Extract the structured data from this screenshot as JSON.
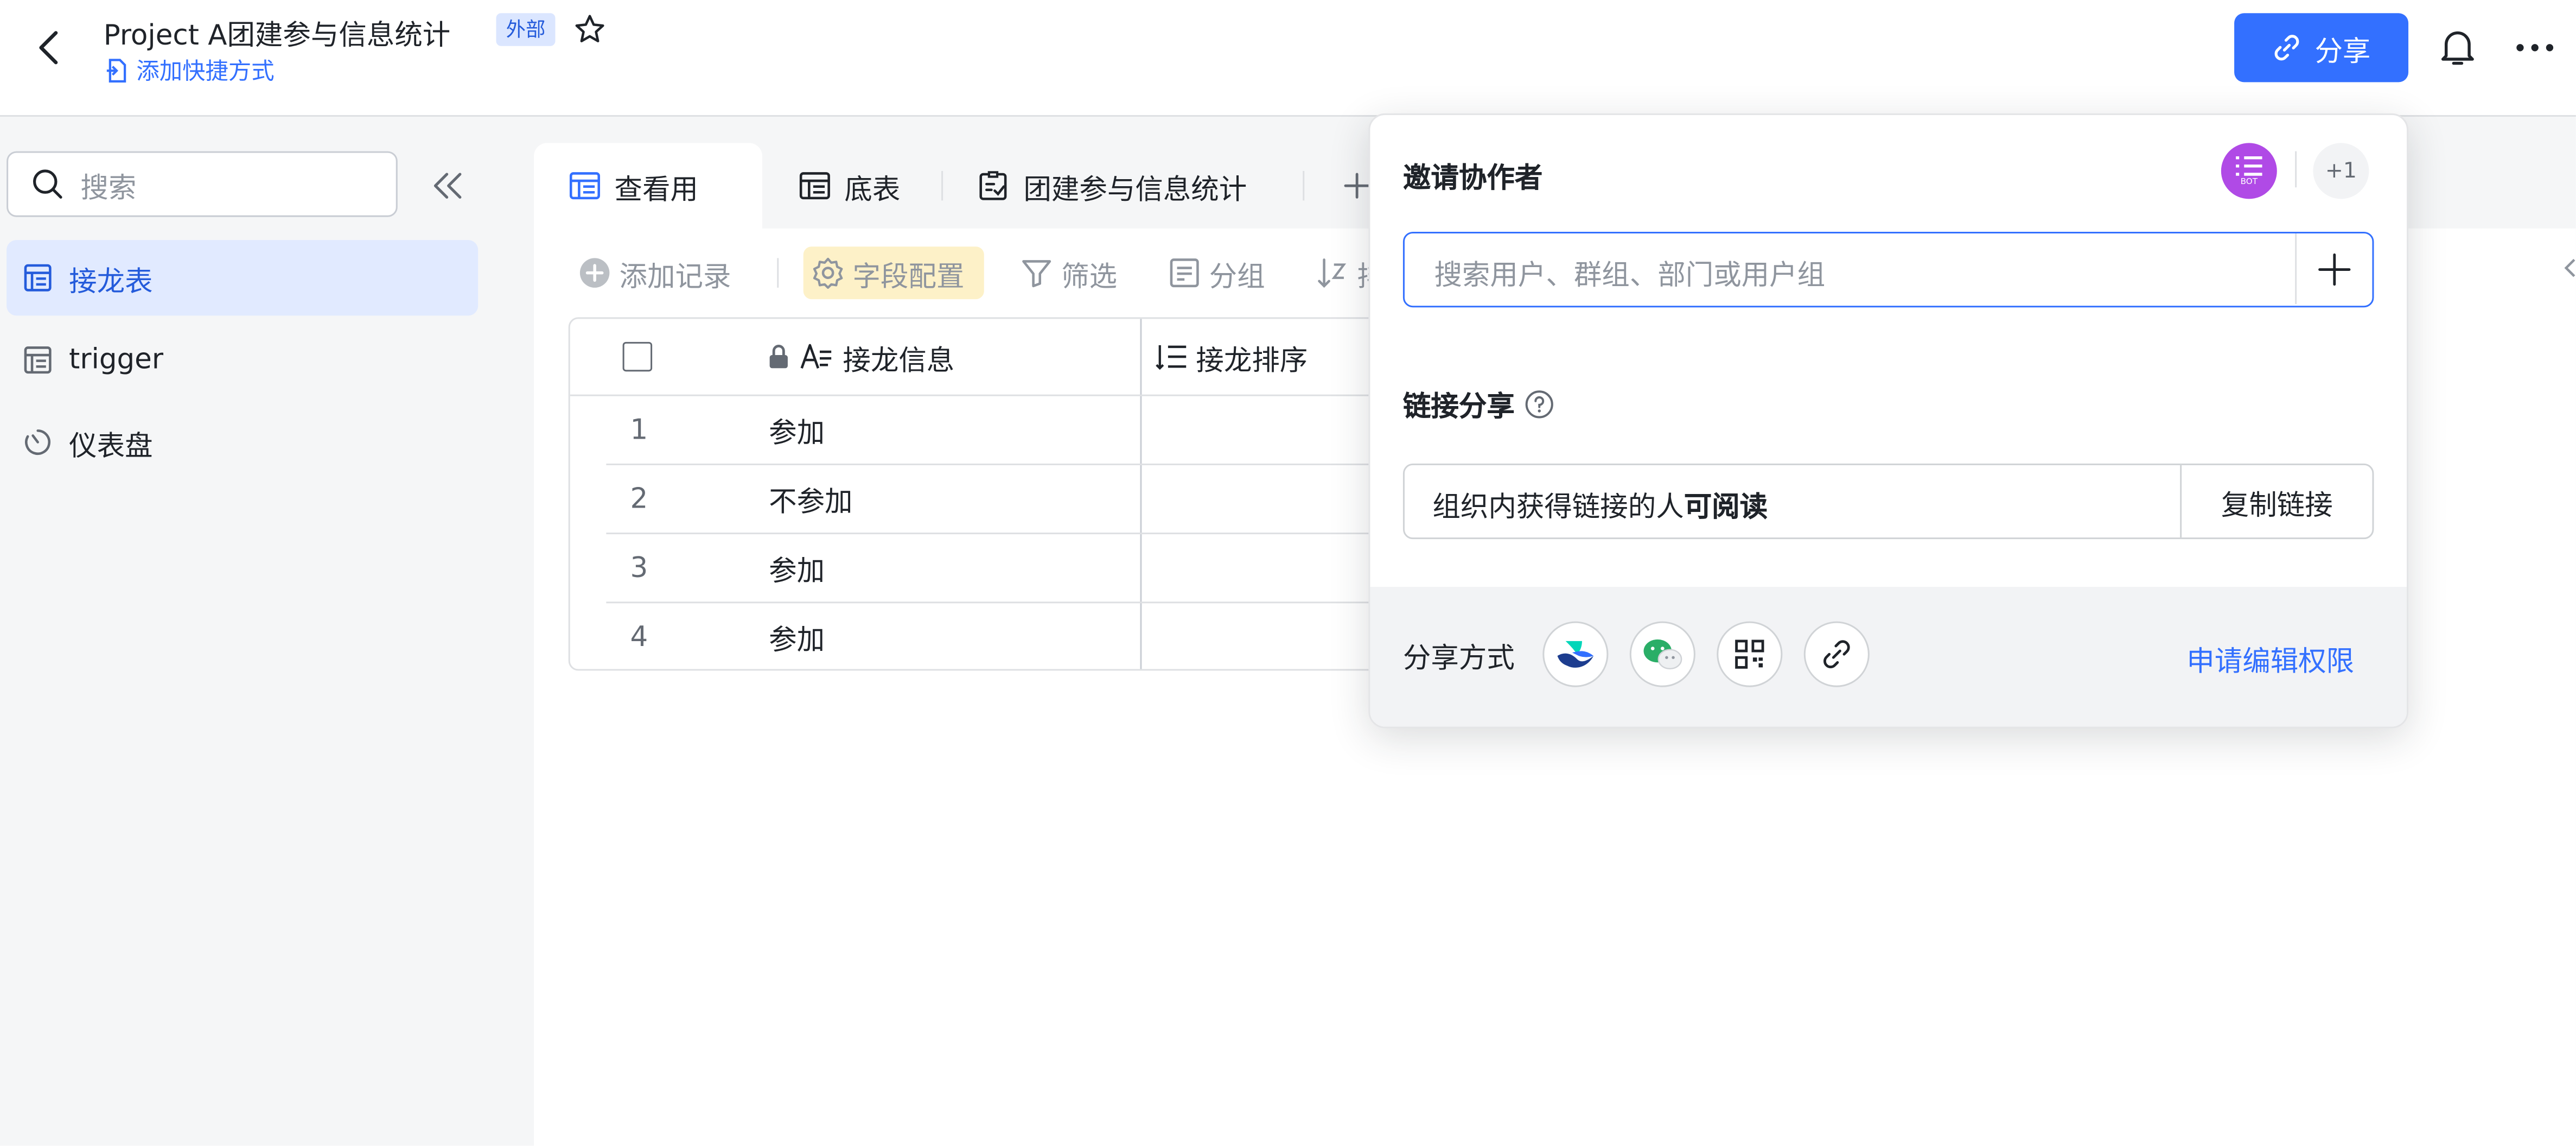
{
  "header": {
    "title": "Project A团建参与信息统计",
    "external_badge": "外部",
    "shortcut_label": "添加快捷方式",
    "share_label": "分享"
  },
  "sidebar": {
    "search_placeholder": "搜索",
    "items": [
      {
        "label": "接龙表",
        "active": true
      },
      {
        "label": "trigger",
        "active": false
      },
      {
        "label": "仪表盘",
        "active": false
      }
    ]
  },
  "tabs": [
    {
      "label": "查看用",
      "active": true
    },
    {
      "label": "底表",
      "active": false
    },
    {
      "label": "团建参与信息统计",
      "active": false
    }
  ],
  "toolbar": {
    "add_record": "添加记录",
    "field_config": "字段配置",
    "filter": "筛选",
    "group": "分组",
    "sort_partial": "排"
  },
  "table": {
    "columns": [
      "接龙信息",
      "接龙排序"
    ],
    "rows": [
      {
        "num": "1",
        "info": "参加"
      },
      {
        "num": "2",
        "info": "不参加"
      },
      {
        "num": "3",
        "info": "参加"
      },
      {
        "num": "4",
        "info": "参加"
      }
    ]
  },
  "share_panel": {
    "invite_title": "邀请协作者",
    "avatar_text": "BOT",
    "more_count": "+1",
    "invite_placeholder": "搜索用户、群组、部门或用户组",
    "link_share_title": "链接分享",
    "link_permission_prefix": "组织内获得链接的人",
    "link_permission_strong": "可阅读",
    "copy_link": "复制链接",
    "share_method_title": "分享方式",
    "request_edit": "申请编辑权限",
    "colors": {
      "accent": "#3370ff",
      "avatar": "#b04ae6",
      "wechat": "#2aae67"
    }
  }
}
